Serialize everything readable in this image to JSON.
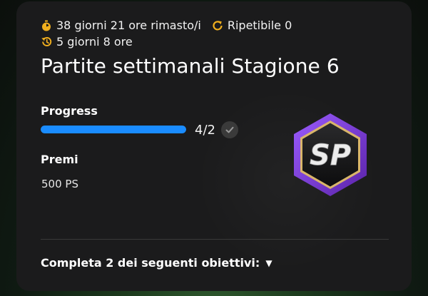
{
  "card": {
    "timer_text": "38 giorni 21 ore rimasto/i",
    "repeat_text": "Ripetibile 0",
    "refresh_text": "5 giorni 8 ore",
    "title": "Partite settimanali Stagione 6"
  },
  "progress": {
    "label": "Progress",
    "text": "4/2",
    "fraction": 1.0
  },
  "rewards": {
    "label": "Premi",
    "value": "500 PS",
    "badge_text": "SP"
  },
  "objectives": {
    "label": "Completa 2 dei seguenti obiettivi:",
    "caret": "▼"
  },
  "colors": {
    "accent_icon": "#f2b01e",
    "progress": "#1a8cff",
    "badge_purple": "#7a3cc8"
  },
  "icons": {
    "timer": "stopwatch-icon",
    "repeat": "repeat-icon",
    "refresh": "history-icon",
    "check": "checkmark-icon"
  }
}
